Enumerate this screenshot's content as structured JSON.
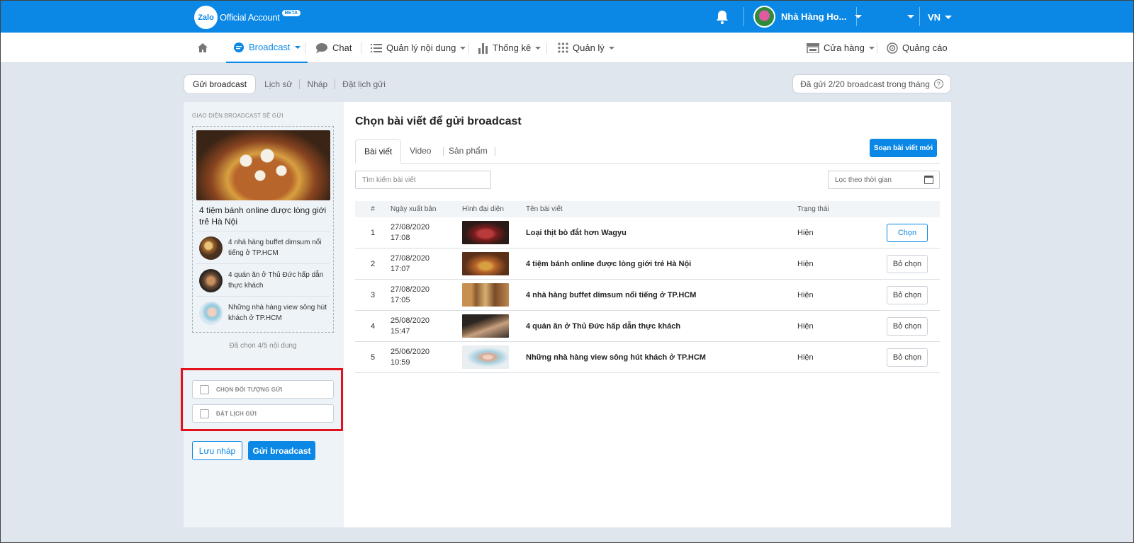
{
  "header": {
    "logo_mark": "Zalo",
    "logo_text": "Official Account",
    "beta": "BETA",
    "profile_name": "Nhà Hàng Ho...",
    "language": "VN"
  },
  "nav": {
    "broadcast": "Broadcast",
    "chat": "Chat",
    "content": "Quản lý nội dung",
    "stats": "Thống kê",
    "manage": "Quản lý",
    "store": "Cửa hàng",
    "ads": "Quảng cáo"
  },
  "subtabs": {
    "send": "Gửi broadcast",
    "history": "Lịch sử",
    "draft": "Nháp",
    "schedule": "Đặt lịch gửi"
  },
  "quota": {
    "text": "Đã gửi 2/20 broadcast trong tháng",
    "help": "?"
  },
  "preview": {
    "label": "GIAO DIỆN BROADCAST SẼ GỬI",
    "hero_title": "4 tiệm bánh online được lòng giới trẻ Hà Nội",
    "items": [
      {
        "title": "4 nhà hàng buffet dimsum nổi tiếng ở TP.HCM"
      },
      {
        "title": "4 quán ăn ở Thủ Đức hấp dẫn thực khách"
      },
      {
        "title": "Những nhà hàng view sông hút khách ở TP.HCM"
      }
    ],
    "selected_count": "Đã chọn 4/5 nội dung"
  },
  "options": {
    "target": "CHỌN ĐỐI TƯỢNG GỬI",
    "schedule": "ĐẶT LỊCH GỬI"
  },
  "actions": {
    "save_draft": "Lưu nháp",
    "send": "Gửi broadcast"
  },
  "main": {
    "title": "Chọn bài viết để gửi broadcast",
    "tabs": [
      "Bài viết",
      "Video",
      "Sản phẩm"
    ],
    "compose": "Soạn bài viết mới",
    "search_placeholder": "Tìm kiếm bài viết",
    "date_filter": "Lọc theo thời gian"
  },
  "table": {
    "headers": [
      "#",
      "Ngày xuất bản",
      "Hình đại diện",
      "Tên bài viết",
      "Trạng thái"
    ],
    "rows": [
      {
        "num": "1",
        "date": "27/08/2020",
        "time": "17:08",
        "title": "Loại thịt bò đắt hơn Wagyu",
        "status": "Hiện",
        "action": "Chọn"
      },
      {
        "num": "2",
        "date": "27/08/2020",
        "time": "17:07",
        "title": "4 tiệm bánh online được lòng giới trẻ Hà Nội",
        "status": "Hiện",
        "action": "Bỏ chọn"
      },
      {
        "num": "3",
        "date": "27/08/2020",
        "time": "17:05",
        "title": "4 nhà hàng buffet dimsum nổi tiếng ở TP.HCM",
        "status": "Hiện",
        "action": "Bỏ chọn"
      },
      {
        "num": "4",
        "date": "25/08/2020",
        "time": "15:47",
        "title": "4 quán ăn ở Thủ Đức hấp dẫn thực khách",
        "status": "Hiện",
        "action": "Bỏ chọn"
      },
      {
        "num": "5",
        "date": "25/06/2020",
        "time": "10:59",
        "title": "Những nhà hàng view sông hút khách ở TP.HCM",
        "status": "Hiện",
        "action": "Bỏ chọn"
      }
    ]
  },
  "colors": {
    "brand": "#0b88e6",
    "highlight": "#e3111b"
  }
}
